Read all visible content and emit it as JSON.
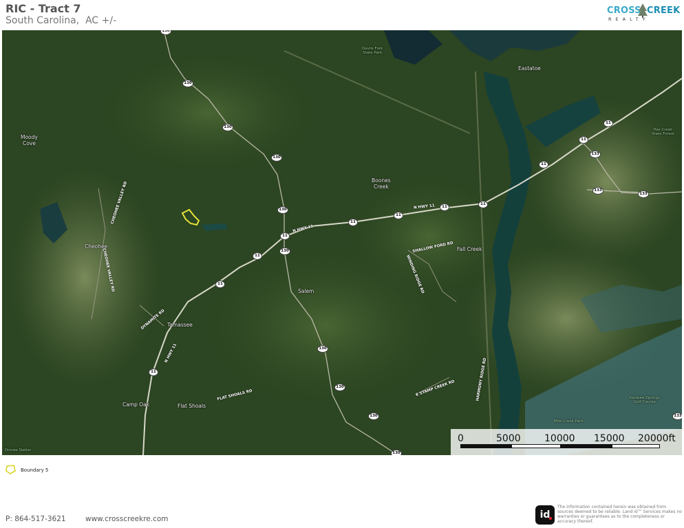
{
  "header": {
    "title": "RIC - Tract 7",
    "subtitle": "South Carolina,  AC +/-"
  },
  "logo": {
    "word_left": "CROSS",
    "word_right": "CREEK",
    "tagline": "REALTY"
  },
  "map": {
    "places": [
      {
        "name": "Moody Cove",
        "lines": [
          "Moody",
          "Cove"
        ]
      },
      {
        "name": "Cheohee",
        "lines": [
          "Cheohee"
        ]
      },
      {
        "name": "Tamassee",
        "lines": [
          "Tamassee"
        ]
      },
      {
        "name": "Camp Oak",
        "lines": [
          "Camp Oak"
        ]
      },
      {
        "name": "Flat Shoals",
        "lines": [
          "Flat Shoals"
        ]
      },
      {
        "name": "Salem",
        "lines": [
          "Salem"
        ]
      },
      {
        "name": "Boones Creek",
        "lines": [
          "Boones",
          "Creek"
        ]
      },
      {
        "name": "Fall Creek",
        "lines": [
          "Fall Creek"
        ]
      },
      {
        "name": "Eastatoe",
        "lines": [
          "Eastatoe"
        ]
      },
      {
        "name": "Devils Fork State Park",
        "lines": [
          "Devils Fork",
          "State Park"
        ]
      },
      {
        "name": "Poe Creek State Forest",
        "lines": [
          "Poe Creek",
          "State Forest"
        ]
      },
      {
        "name": "Keowee Springs Golf Course",
        "lines": [
          "Keowee Springs",
          "Golf Course"
        ]
      },
      {
        "name": "Mile Creek Park",
        "lines": [
          "Mile Creek Park"
        ]
      },
      {
        "name": "Oconee Station",
        "lines": [
          "Oconee Station"
        ]
      }
    ],
    "road_labels": [
      "N HWY 11",
      "N HWY 11",
      "N HWY 11",
      "SHALLOW FORD RD",
      "DYNAMITE RD",
      "FLAT SHOALS RD",
      "E STAMP CREEK RD",
      "CHEOHEE VALLEY RD",
      "CHEOHEE VALLEY RD",
      "WINDING RIDGE RD",
      "HARMONY RIDGE RD"
    ],
    "shields": [
      "130",
      "130",
      "130",
      "130",
      "130",
      "130",
      "130",
      "130",
      "130",
      "130",
      "11",
      "11",
      "11",
      "11",
      "11",
      "11",
      "11",
      "11",
      "11",
      "11",
      "11",
      "133",
      "133",
      "133",
      "133"
    ],
    "scale": {
      "labels": [
        "0",
        "5000",
        "10000",
        "15000",
        "20000ft"
      ]
    },
    "colors": {
      "forest": "#27401f",
      "water": "#16403e",
      "boundary": "#e8e23a"
    }
  },
  "legend": {
    "label": "Boundary 5",
    "icon": "boundary-polygon-icon"
  },
  "footer": {
    "phone": "P: 864-517-3621",
    "website": "www.crosscreekre.com",
    "id_logo_text": "id",
    "disclaimer": "The information contained herein was obtained from sources deemed to be reliable. Land id™ Services makes no warranties or guarantees as to the completeness or accuracy thereof."
  }
}
